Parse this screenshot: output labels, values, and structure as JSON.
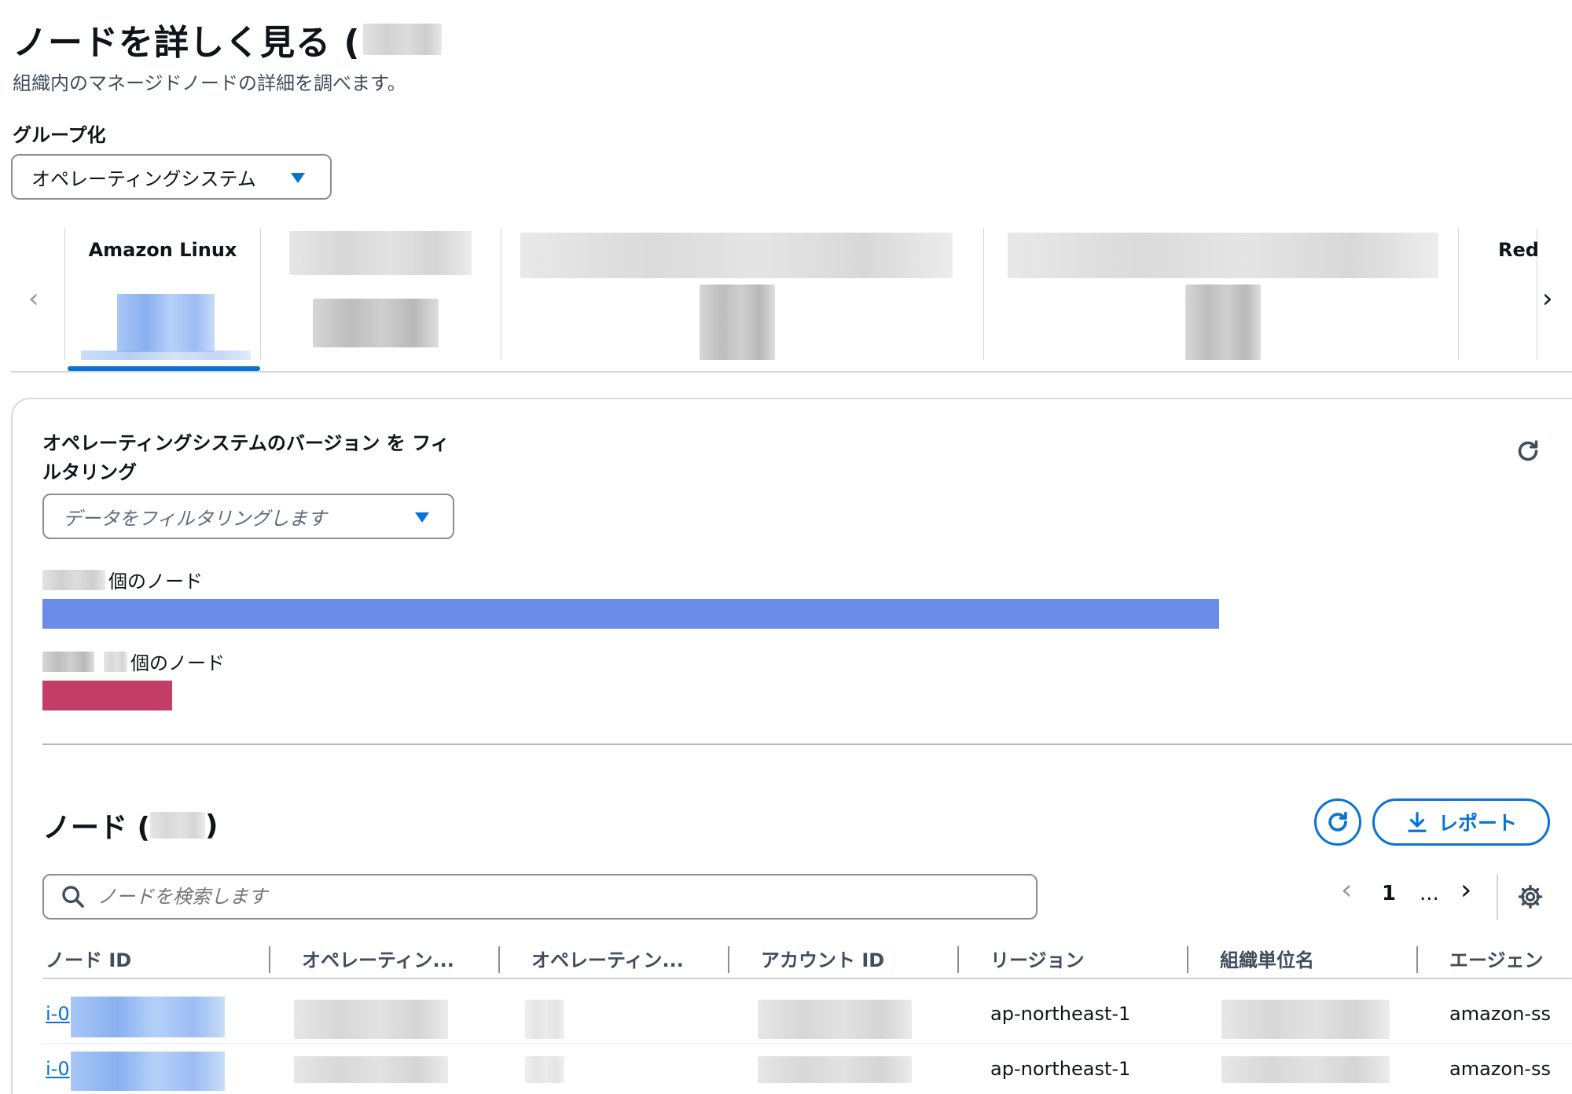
{
  "page": {
    "title": "ノードを詳しく見る (",
    "subtitle": "組織内のマネージドノードの詳細を調べます。"
  },
  "grouping": {
    "label": "グループ化",
    "selected": "オペレーティングシステム"
  },
  "carousel": {
    "cards": [
      "Amazon Linux",
      "",
      "",
      "",
      "Red"
    ]
  },
  "filter": {
    "label": "オペレーティングシステムのバージョン を フィルタリング",
    "placeholder": "データをフィルタリングします"
  },
  "bars": [
    {
      "label": "個のノード",
      "fraction": 1.0,
      "color": "#6b8ce8"
    },
    {
      "label": "個のノード",
      "fraction": 0.11,
      "color": "#c33d69"
    }
  ],
  "nodes": {
    "title": "ノード (",
    "title_close": ")",
    "report_label": "レポート",
    "search_placeholder": "ノードを検索します",
    "page_current": "1",
    "page_ellipsis": "..."
  },
  "table": {
    "columns": [
      "ノード ID",
      "オペレーティン...",
      "オペレーティン...",
      "アカウント ID",
      "リージョン",
      "組織単位名",
      "エージェン"
    ],
    "rows": [
      {
        "node_id": "i-0",
        "region": "ap-northeast-1",
        "agent": "amazon-ss"
      },
      {
        "node_id": "i-0",
        "region": "ap-northeast-1",
        "agent": "amazon-ss"
      }
    ]
  },
  "colors": {
    "accent": "#0972d3",
    "bar_primary": "#6b8ce8",
    "bar_secondary": "#c33d69"
  }
}
